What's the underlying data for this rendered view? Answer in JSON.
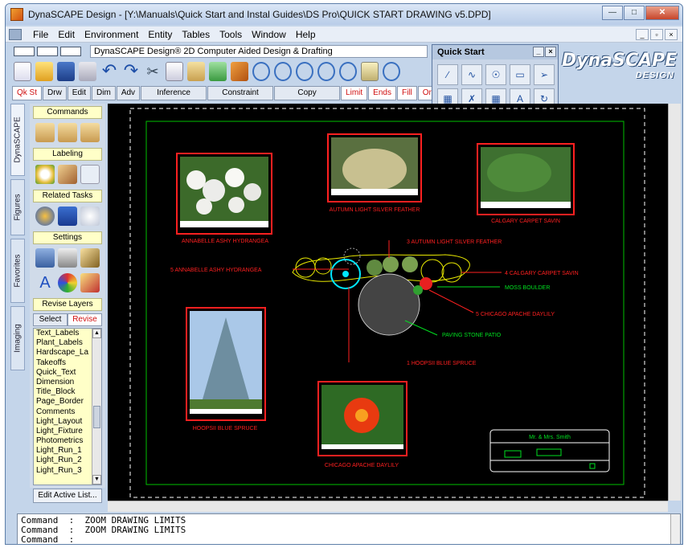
{
  "window": {
    "title": "DynaSCAPE Design  - [Y:\\Manuals\\Quick Start and Instal Guides\\DS Pro\\QUICK START DRAWING v5.DPD]"
  },
  "menu": [
    "File",
    "Edit",
    "Environment",
    "Entity",
    "Tables",
    "Tools",
    "Window",
    "Help"
  ],
  "drawing_caption": "DynaSCAPE Design® 2D Computer Aided Design & Drafting",
  "tabs": [
    "Qk St",
    "Drw",
    "Edit",
    "Dim",
    "Adv",
    "Inference",
    "Constraint",
    "Copy",
    "Limit",
    "Ends",
    "Fill",
    "Org"
  ],
  "quickstart": {
    "title": "Quick Start"
  },
  "logo": {
    "name": "DynaSCAPE",
    "sub": "DESIGN"
  },
  "vtabs": [
    "DynaSCAPE",
    "Figures",
    "Favorites",
    "Imaging"
  ],
  "panel": {
    "commands": "Commands",
    "labeling": "Labeling",
    "related": "Related Tasks",
    "settings": "Settings",
    "revise_layers": "Revise Layers",
    "select": "Select",
    "revise": "Revise",
    "layers": [
      "Text_Labels",
      "Plant_Labels",
      "Hardscape_La",
      "Takeoffs",
      "Quick_Text",
      "Dimension",
      "Title_Block",
      "Page_Border",
      "Comments",
      "Light_Layout",
      "Light_Fixture",
      "Photometrics",
      "Light_Run_1",
      "Light_Run_2",
      "Light_Run_3"
    ],
    "edit_active": "Edit Active List..."
  },
  "drawing": {
    "photo_labels": [
      "ANNABELLE ASHY HYDRANGEA",
      "AUTUMN LIGHT SILVER FEATHER",
      "CALGARY CARPET SAVIN",
      "HOOPSII BLUE SPRUCE",
      "CHICAGO APACHE DAYLILY"
    ],
    "callouts": [
      "3 AUTUMN LIGHT SILVER FEATHER",
      "5 ANNABELLE ASHY HYDRANGEA",
      "4 CALGARY CARPET SAVIN",
      "MOSS BOULDER",
      "5 CHICAGO APACHE DAYLILY",
      "PAVING STONE PATIO",
      "1 HOOPSII BLUE SPRUCE"
    ],
    "titleblock": "Mr. & Mrs. Smith"
  },
  "command_lines": [
    "Command  :  ZOOM DRAWING LIMITS",
    "Command  :  ZOOM DRAWING LIMITS",
    "Command  :"
  ],
  "colors": {
    "accent_red": "#d01010",
    "canvas": "#000000",
    "border_green": "#00c000",
    "label_red": "#ff2020"
  }
}
